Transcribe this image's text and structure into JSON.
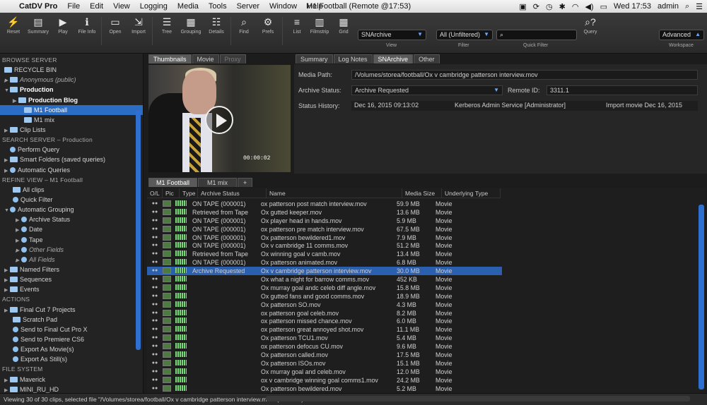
{
  "menubar": {
    "apple": "",
    "app": "CatDV Pro",
    "items": [
      "File",
      "Edit",
      "View",
      "Logging",
      "Media",
      "Tools",
      "Server",
      "Window",
      "Help"
    ],
    "window_title": "M1 Football (Remote @17:53)",
    "clock": "Wed 17:53",
    "user": "admin"
  },
  "toolbar": {
    "buttons": [
      {
        "label": "Reset",
        "icon": "⚡"
      },
      {
        "label": "Summary",
        "icon": "▤"
      },
      {
        "label": "Play",
        "icon": "▶"
      },
      {
        "label": "File Info",
        "icon": "ℹ"
      },
      {
        "label": "Open",
        "icon": "▭"
      },
      {
        "label": "Import",
        "icon": "⇲"
      },
      {
        "label": "Tree",
        "icon": "☰"
      },
      {
        "label": "Grouping",
        "icon": "▦"
      },
      {
        "label": "Details",
        "icon": "☷"
      },
      {
        "label": "Find",
        "icon": "⌕"
      },
      {
        "label": "Prefs",
        "icon": "⚙"
      },
      {
        "label": "List",
        "icon": "≡"
      },
      {
        "label": "Filmstrip",
        "icon": "▥"
      },
      {
        "label": "Grid",
        "icon": "▦"
      }
    ],
    "view_select": "SNArchive",
    "view_label": "View",
    "filter_select": "All (Unfiltered)",
    "filter_label": "Filter",
    "quick_filter_label": "Quick Filter",
    "query_label": "Query",
    "workspace_select": "Advanced",
    "workspace_label": "Workspace"
  },
  "sidebar": {
    "browse_header": "BROWSE SERVER",
    "recycle": "RECYCLE BIN",
    "anon": "Anonymous (public)",
    "production": "Production",
    "prod_blog": "Production Blog",
    "m1_football": "M1 Football",
    "m1_mix": "M1 mix",
    "clip_lists": "Clip Lists",
    "search_header": "SEARCH SERVER – Production",
    "perform_query": "Perform Query",
    "smart_folders": "Smart Folders (saved queries)",
    "auto_queries": "Automatic Queries",
    "refine_header": "REFINE VIEW – M1 Football",
    "all_clips": "All clips",
    "quick_filter": "Quick Filter",
    "auto_grouping": "Automatic Grouping",
    "archive_status": "Archive Status",
    "date": "Date",
    "tape": "Tape",
    "other_fields": "Other Fields",
    "all_fields": "All Fields",
    "named_filters": "Named Filters",
    "sequences": "Sequences",
    "events": "Events",
    "actions_header": "ACTIONS",
    "fcp7": "Final Cut 7 Projects",
    "scratch": "Scratch Pad",
    "send_fcpx": "Send to Final Cut Pro X",
    "send_premiere": "Send to Premiere CS6",
    "export_movies": "Export As Movie(s)",
    "export_stills": "Export As Still(s)",
    "filesystem_header": "FILE SYSTEM",
    "maverick": "Maverick",
    "mini": "MINI_RU_HD"
  },
  "thumb_tabs": [
    "Thumbnails",
    "Movie",
    "Proxy"
  ],
  "video": {
    "timecode": "00:00:02"
  },
  "meta_tabs": [
    "Summary",
    "Log Notes",
    "SNArchive",
    "Other"
  ],
  "meta": {
    "media_path_label": "Media Path:",
    "media_path": "/Volumes/storea/football/Ox v cambridge patterson interview.mov",
    "archive_status_label": "Archive Status:",
    "archive_status": "Archive Requested",
    "remote_id_label": "Remote ID:",
    "remote_id": "3311.1",
    "status_history_label": "Status History:",
    "history_date": "Dec 16, 2015 09:13:02",
    "history_by": "Kerberos Admin Service [Administrator]",
    "history_action": "Import movie Dec 16, 2015"
  },
  "bottom_tabs": [
    "M1 Football",
    "M1 mix",
    "+"
  ],
  "grid": {
    "columns": [
      "O/L",
      "Pic",
      "Type",
      "Archive Status",
      "Name",
      "Media Size",
      "Underlying Type"
    ],
    "rows": [
      {
        "status": "ON TAPE (000001)",
        "name": "ox patterson post match interview.mov",
        "size": "59.9 MB",
        "type": "Movie"
      },
      {
        "status": "Retrieved from Tape",
        "name": "Ox gutted keeper.mov",
        "size": "13.6 MB",
        "type": "Movie"
      },
      {
        "status": "ON TAPE (000001)",
        "name": "Ox player head in hands.mov",
        "size": "5.9 MB",
        "type": "Movie"
      },
      {
        "status": "ON TAPE (000001)",
        "name": "ox patterson pre match interview.mov",
        "size": "67.5 MB",
        "type": "Movie"
      },
      {
        "status": "ON TAPE (000001)",
        "name": "Ox patterson bewildered1.mov",
        "size": "7.9 MB",
        "type": "Movie"
      },
      {
        "status": "ON TAPE (000001)",
        "name": "Ox v cambridge 11 comms.mov",
        "size": "51.2 MB",
        "type": "Movie"
      },
      {
        "status": "Retrieved from Tape",
        "name": "Ox winning goal v camb.mov",
        "size": "13.4 MB",
        "type": "Movie"
      },
      {
        "status": "ON TAPE (000001)",
        "name": "Ox  patterson animated.mov",
        "size": "6.8 MB",
        "type": "Movie"
      },
      {
        "status": "Archive Requested",
        "name": "Ox v cambridge patterson interview.mov",
        "size": "30.0 MB",
        "type": "Movie",
        "selected": true
      },
      {
        "status": "",
        "name": "Ox what a night for barrow comms.mov",
        "size": "452 KB",
        "type": "Movie"
      },
      {
        "status": "",
        "name": "Ox  murray goal andc celeb diff angle.mov",
        "size": "15.8 MB",
        "type": "Movie"
      },
      {
        "status": "",
        "name": "Ox gutted fans and good comms.mov",
        "size": "18.9 MB",
        "type": "Movie"
      },
      {
        "status": "",
        "name": "Ox patterson SO.mov",
        "size": "4.3 MB",
        "type": "Movie"
      },
      {
        "status": "",
        "name": "ox patterson goal celeb.mov",
        "size": "8.2 MB",
        "type": "Movie"
      },
      {
        "status": "",
        "name": "ox patterson missed chance.mov",
        "size": "6.0 MB",
        "type": "Movie"
      },
      {
        "status": "",
        "name": "ox patterson great  annoyed shot.mov",
        "size": "11.1 MB",
        "type": "Movie"
      },
      {
        "status": "",
        "name": "Ox patterson TCU1.mov",
        "size": "5.4 MB",
        "type": "Movie"
      },
      {
        "status": "",
        "name": "ox patterson defocus CU.mov",
        "size": "9.6 MB",
        "type": "Movie"
      },
      {
        "status": "",
        "name": "Ox patterson called.mov",
        "size": "17.5 MB",
        "type": "Movie"
      },
      {
        "status": "",
        "name": "Ox patterson ISOs.mov",
        "size": "15.1 MB",
        "type": "Movie"
      },
      {
        "status": "",
        "name": "Ox murray goal and celeb.mov",
        "size": "12.0 MB",
        "type": "Movie"
      },
      {
        "status": "",
        "name": "ox v cambridge winning goal comms1.mov",
        "size": "24.2 MB",
        "type": "Movie"
      },
      {
        "status": "",
        "name": "Ox patterson bewildered.mov",
        "size": "5.2 MB",
        "type": "Movie"
      }
    ]
  },
  "status_bar": "Viewing 30 of 30 clips, selected file \"/Volumes/storea/football/Ox v cambridge patterson interview.mov\" (30.0 MB)"
}
